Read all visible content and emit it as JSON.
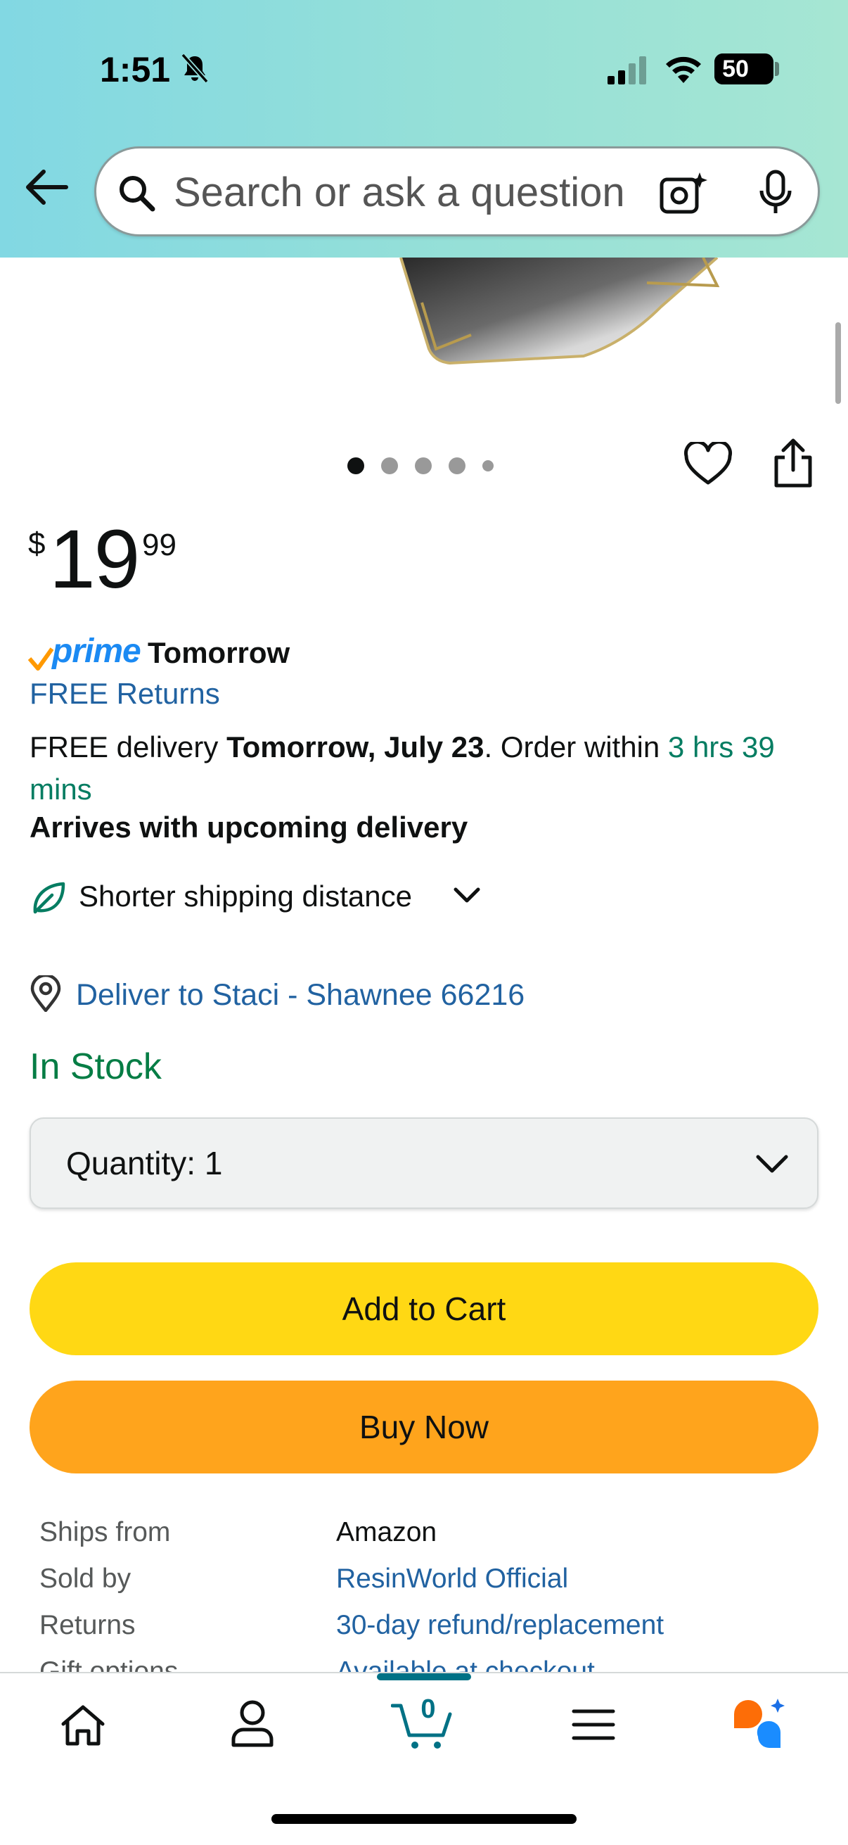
{
  "status_bar": {
    "time": "1:51",
    "battery": "50",
    "battery_level_percent": 50
  },
  "search": {
    "placeholder": "Search or ask a question"
  },
  "carousel": {
    "count": 5,
    "active_index": 0
  },
  "price": {
    "symbol": "$",
    "whole": "19",
    "fraction": "99"
  },
  "prime": {
    "logo": "prime",
    "day": "Tomorrow"
  },
  "returns_link": "FREE Returns",
  "delivery": {
    "prefix": "FREE delivery ",
    "date": "Tomorrow, July 23",
    "mid": ". Order within ",
    "countdown": "3 hrs 39 mins"
  },
  "arrives": "Arrives with upcoming delivery",
  "shipping_distance": "Shorter shipping distance",
  "deliver_to": "Deliver to Staci - Shawnee 66216",
  "stock": "In Stock",
  "quantity": {
    "label": "Quantity:",
    "value": "1"
  },
  "buttons": {
    "add_to_cart": "Add to Cart",
    "buy_now": "Buy Now"
  },
  "info_rows": [
    {
      "key": "Ships from",
      "value": "Amazon"
    },
    {
      "key": "Sold by",
      "value": "ResinWorld Official"
    },
    {
      "key": "Returns",
      "value": "30-day refund/replacement"
    },
    {
      "key": "Gift options",
      "value": "Available at checkout"
    }
  ],
  "nav": {
    "items": [
      "home-icon",
      "account-icon",
      "cart-icon",
      "menu-icon",
      "rufus-icon"
    ],
    "cart_count": "0"
  },
  "colors": {
    "header_gradient_start": "#82d8e3",
    "header_gradient_end": "#a6e6d3",
    "link": "#2162a1",
    "green": "#067d62",
    "stock_green": "#067d45",
    "add_to_cart": "#ffd814",
    "buy_now": "#ffa41c",
    "prime_blue": "#1b8af3",
    "nav_active": "#007185"
  }
}
